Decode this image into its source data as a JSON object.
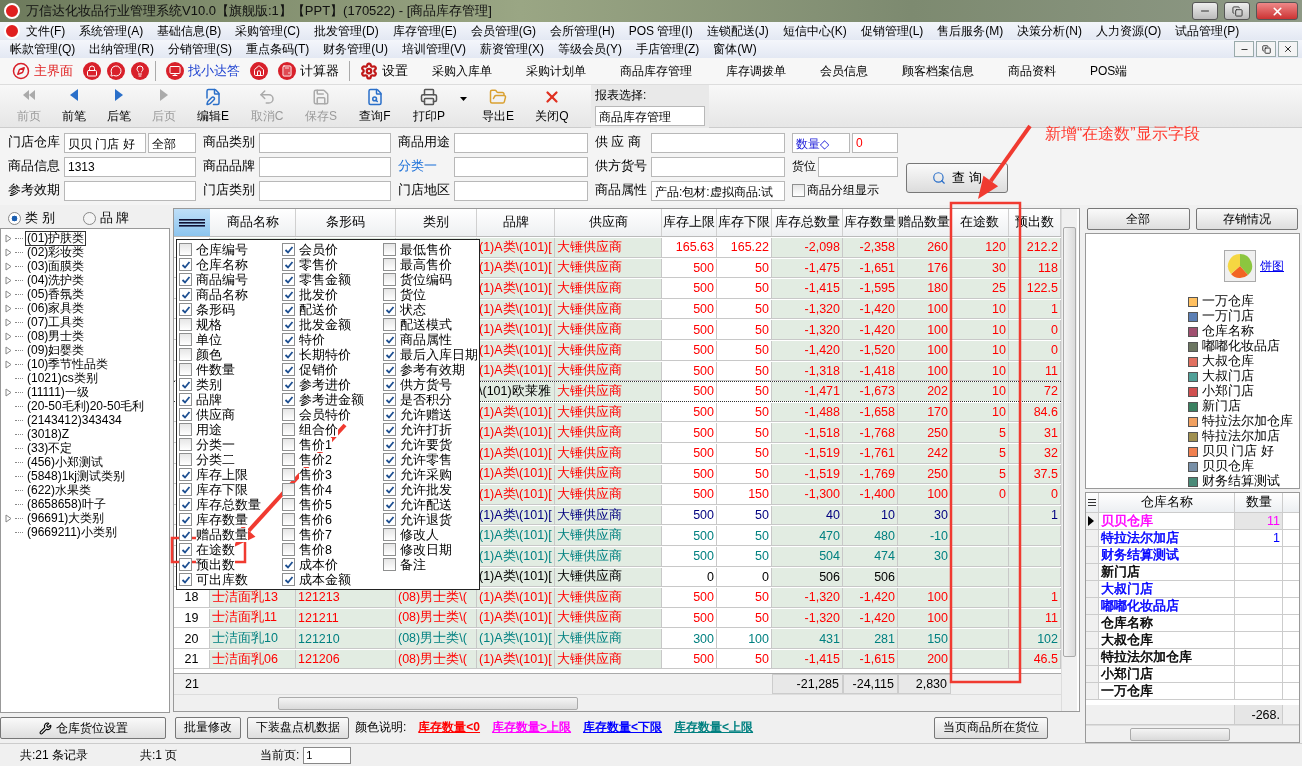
{
  "window": {
    "title": "万信达化妆品行业管理系统V10.0【旗舰版:1】【PPT】(170522) - [商品库存管理]"
  },
  "menus": [
    [
      "文件(F)",
      "系统管理(A)",
      "基础信息(B)",
      "采购管理(C)",
      "批发管理(D)",
      "库存管理(E)",
      "会员管理(G)",
      "会所管理(H)",
      "POS 管理(I)",
      "连锁配送(J)",
      "短信中心(K)",
      "促销管理(L)",
      "售后服务(M)",
      "决策分析(N)",
      "人力资源(O)",
      "试品管理(P)"
    ],
    [
      "帐款管理(Q)",
      "出纳管理(R)",
      "分销管理(S)",
      "重点条码(T)",
      "财务管理(U)",
      "培训管理(V)",
      "薪资管理(X)",
      "等级会员(Y)",
      "手店管理(Z)",
      "窗体(W)"
    ]
  ],
  "quick_bar": [
    {
      "kind": "home",
      "label": "主界面"
    },
    {
      "kind": "lock"
    },
    {
      "kind": "chat"
    },
    {
      "kind": "bulb"
    },
    {
      "kind": "separator"
    },
    {
      "kind": "help",
      "label": "找小达答"
    },
    {
      "kind": "house"
    },
    {
      "kind": "calculator",
      "label": "计算器"
    },
    {
      "kind": "separator"
    },
    {
      "kind": "settings",
      "label": "设置"
    },
    {
      "kind": "link",
      "label": "采购入库单"
    },
    {
      "kind": "link",
      "label": "采购计划单"
    },
    {
      "kind": "link",
      "label": "商品库存管理"
    },
    {
      "kind": "link",
      "label": "库存调拨单"
    },
    {
      "kind": "link",
      "label": "会员信息"
    },
    {
      "kind": "link",
      "label": "顾客档案信息"
    },
    {
      "kind": "link",
      "label": "商品资料"
    },
    {
      "kind": "link",
      "label": "POS端"
    }
  ],
  "toolbar": [
    {
      "kind": "first",
      "label": "前页",
      "disabled": true
    },
    {
      "kind": "prev",
      "label": "前笔",
      "disabled": false
    },
    {
      "kind": "next",
      "label": "后笔",
      "disabled": false
    },
    {
      "kind": "last",
      "label": "后页",
      "disabled": true
    },
    {
      "kind": "edit",
      "label": "编辑E",
      "disabled": false
    },
    {
      "kind": "cancel",
      "label": "取消C",
      "disabled": true
    },
    {
      "kind": "save",
      "label": "保存S",
      "disabled": true
    },
    {
      "kind": "query",
      "label": "查询F",
      "disabled": false
    },
    {
      "kind": "print",
      "label": "打印P",
      "disabled": false
    },
    {
      "kind": "dropdown"
    },
    {
      "kind": "export",
      "label": "导出E",
      "disabled": false
    },
    {
      "kind": "close",
      "label": "关闭Q",
      "disabled": false
    }
  ],
  "report_select": {
    "label": "报表选择:",
    "value": "商品库存管理"
  },
  "filters": [
    [
      {
        "kind": "field",
        "label": "门店仓库",
        "value": "贝贝 门店 好",
        "extra": "全部"
      },
      {
        "kind": "field",
        "label": "商品类别"
      },
      {
        "kind": "field",
        "label": "商品用途"
      },
      {
        "kind": "field",
        "label": "供 应 商"
      },
      {
        "kind": "compare",
        "label": "数量◇",
        "value": "0"
      }
    ],
    [
      {
        "kind": "field",
        "label": "商品信息",
        "value": "1313"
      },
      {
        "kind": "field",
        "label": "商品品牌"
      },
      {
        "kind": "link",
        "label": "分类一"
      },
      {
        "kind": "field",
        "label": "供方货号"
      },
      {
        "kind": "small",
        "label": "货位"
      }
    ],
    [
      {
        "kind": "field",
        "label": "参考效期"
      },
      {
        "kind": "field",
        "label": "门店类别"
      },
      {
        "kind": "field",
        "label": "门店地区"
      },
      {
        "kind": "field",
        "label": "商品属性",
        "value": "产品:包材:虚拟商品:试"
      },
      {
        "kind": "checkbox",
        "label": "商品分组显示",
        "checked": false
      }
    ]
  ],
  "query_button": "查 询",
  "annotation": {
    "note": "新增“在途数”显示字段"
  },
  "category_switch": [
    {
      "label": "类 别",
      "selected": true
    },
    {
      "label": "品 牌",
      "selected": false
    }
  ],
  "tree": [
    {
      "kind": "branch",
      "label": "(01)护肤类",
      "selected": true
    },
    {
      "kind": "branch",
      "label": "(02)彩妆类",
      "selected": false
    },
    {
      "kind": "branch",
      "label": "(03)面膜类",
      "selected": false
    },
    {
      "kind": "branch",
      "label": "(04)洗护类",
      "selected": false
    },
    {
      "kind": "branch",
      "label": "(05)香氛类",
      "selected": false
    },
    {
      "kind": "branch",
      "label": "(06)家具类",
      "selected": false
    },
    {
      "kind": "branch",
      "label": "(07)工具类",
      "selected": false
    },
    {
      "kind": "branch",
      "label": "(08)男士类",
      "selected": false
    },
    {
      "kind": "branch",
      "label": "(09)妇婴类",
      "selected": false
    },
    {
      "kind": "branch",
      "label": "(10)季节性品类",
      "selected": false
    },
    {
      "kind": "leaf",
      "label": "(1021)cs类别",
      "selected": false
    },
    {
      "kind": "branch",
      "label": "(11111)一级",
      "selected": false
    },
    {
      "kind": "leaf",
      "label": "(20-50毛利)20-50毛利",
      "selected": false
    },
    {
      "kind": "leaf",
      "label": "(2143412)343434",
      "selected": false
    },
    {
      "kind": "leaf",
      "label": "(3018)Z",
      "selected": false
    },
    {
      "kind": "leaf",
      "label": "(33)不定",
      "selected": false
    },
    {
      "kind": "leaf",
      "label": "(456)小郑测试",
      "selected": false
    },
    {
      "kind": "leaf",
      "label": "(5848)1kj测试类别",
      "selected": false
    },
    {
      "kind": "leaf",
      "label": "(622)水果类",
      "selected": false
    },
    {
      "kind": "leaf",
      "label": "(8658658)叶子",
      "selected": false
    },
    {
      "kind": "branch",
      "label": "(96691)大类别",
      "selected": false
    },
    {
      "kind": "leaf",
      "label": "(9669211)小类别",
      "selected": false
    }
  ],
  "location_settings_button": "仓库货位设置",
  "grid": {
    "columns": [
      {
        "label": "商品名称",
        "sorted": false
      },
      {
        "label": "条形码",
        "sorted": false
      },
      {
        "label": "类别",
        "sorted": false
      },
      {
        "label": "品牌",
        "sorted": false
      },
      {
        "label": "供应商",
        "sorted": false
      },
      {
        "label": "库存上限",
        "sorted": false
      },
      {
        "label": "库存下限",
        "sorted": false
      },
      {
        "label": "库存总数量",
        "sorted": false
      },
      {
        "label": "库存数量",
        "sorted": false
      },
      {
        "label": "赠品数量",
        "sorted": false
      },
      {
        "label": "在途数",
        "sorted": true
      },
      {
        "label": "预出数",
        "sorted": false
      }
    ],
    "rows": [
      {
        "color": "#ff0000",
        "selected": false,
        "brand": "(1)A类\\(101)[",
        "supplier": "大锤供应商",
        "stock_max": "165.63",
        "stock_min": "165.22",
        "stock_total": "-2,098",
        "stock_qty": "-2,358",
        "gift_qty": "260",
        "in_transit": "120",
        "pre_out": "212.2"
      },
      {
        "color": "#ff0000",
        "selected": false,
        "brand": "(1)A类\\(101)[",
        "supplier": "大锤供应商",
        "stock_max": "500",
        "stock_min": "50",
        "stock_total": "-1,475",
        "stock_qty": "-1,651",
        "gift_qty": "176",
        "in_transit": "30",
        "pre_out": "118"
      },
      {
        "color": "#ff0000",
        "selected": false,
        "brand": "(1)A类\\(101)[",
        "supplier": "大锤供应商",
        "stock_max": "500",
        "stock_min": "50",
        "stock_total": "-1,415",
        "stock_qty": "-1,595",
        "gift_qty": "180",
        "in_transit": "25",
        "pre_out": "122.5"
      },
      {
        "color": "#ff0000",
        "selected": false,
        "brand": "(1)A类\\(101)[",
        "supplier": "大锤供应商",
        "stock_max": "500",
        "stock_min": "50",
        "stock_total": "-1,320",
        "stock_qty": "-1,420",
        "gift_qty": "100",
        "in_transit": "10",
        "pre_out": "1"
      },
      {
        "color": "#ff0000",
        "selected": false,
        "brand": "(1)A类\\(101)[",
        "supplier": "大锤供应商",
        "stock_max": "500",
        "stock_min": "50",
        "stock_total": "-1,320",
        "stock_qty": "-1,420",
        "gift_qty": "100",
        "in_transit": "10",
        "pre_out": "0"
      },
      {
        "color": "#ff0000",
        "selected": false,
        "brand": "(1)A类\\(101)[",
        "supplier": "大锤供应商",
        "stock_max": "500",
        "stock_min": "50",
        "stock_total": "-1,420",
        "stock_qty": "-1,520",
        "gift_qty": "100",
        "in_transit": "10",
        "pre_out": "0"
      },
      {
        "color": "#ff0000",
        "selected": false,
        "brand": "(1)A类\\(101)[",
        "supplier": "大锤供应商",
        "stock_max": "500",
        "stock_min": "50",
        "stock_total": "-1,318",
        "stock_qty": "-1,418",
        "gift_qty": "100",
        "in_transit": "10",
        "pre_out": "11"
      },
      {
        "color": "#ff0000",
        "selected": true,
        "brand": "\\(101)欧莱雅",
        "supplier": "大锤供应商",
        "stock_max": "500",
        "stock_min": "50",
        "stock_total": "-1,471",
        "stock_qty": "-1,673",
        "gift_qty": "202",
        "in_transit": "10",
        "pre_out": "72"
      },
      {
        "color": "#ff0000",
        "selected": false,
        "brand": "(1)A类\\(101)[",
        "supplier": "大锤供应商",
        "stock_max": "500",
        "stock_min": "50",
        "stock_total": "-1,488",
        "stock_qty": "-1,658",
        "gift_qty": "170",
        "in_transit": "10",
        "pre_out": "84.6"
      },
      {
        "color": "#ff0000",
        "selected": false,
        "brand": "(1)A类\\(101)[",
        "supplier": "大锤供应商",
        "stock_max": "500",
        "stock_min": "50",
        "stock_total": "-1,518",
        "stock_qty": "-1,768",
        "gift_qty": "250",
        "in_transit": "5",
        "pre_out": "31"
      },
      {
        "color": "#ff0000",
        "selected": false,
        "brand": "(1)A类\\(101)[",
        "supplier": "大锤供应商",
        "stock_max": "500",
        "stock_min": "50",
        "stock_total": "-1,519",
        "stock_qty": "-1,761",
        "gift_qty": "242",
        "in_transit": "5",
        "pre_out": "32"
      },
      {
        "color": "#ff0000",
        "selected": false,
        "brand": "(1)A类\\(101)[",
        "supplier": "大锤供应商",
        "stock_max": "500",
        "stock_min": "50",
        "stock_total": "-1,519",
        "stock_qty": "-1,769",
        "gift_qty": "250",
        "in_transit": "5",
        "pre_out": "37.5"
      },
      {
        "color": "#ff0000",
        "selected": false,
        "brand": "(1)A类\\(101)[",
        "supplier": "大锤供应商",
        "stock_max": "500",
        "stock_min": "150",
        "stock_total": "-1,300",
        "stock_qty": "-1,400",
        "gift_qty": "100",
        "in_transit": "0",
        "pre_out": "0"
      },
      {
        "color": "#00007f",
        "selected": false,
        "brand": "(1)A类\\(101)[",
        "supplier": "大锤供应商",
        "stock_max": "500",
        "stock_min": "50",
        "stock_total": "40",
        "stock_qty": "10",
        "gift_qty": "30",
        "pre_out": "1"
      },
      {
        "color": "#008080",
        "selected": false,
        "brand": "(1)A类\\(101)[",
        "supplier": "大锤供应商",
        "stock_max": "500",
        "stock_min": "50",
        "stock_total": "470",
        "stock_qty": "480",
        "gift_qty": "-10"
      },
      {
        "color": "#008080",
        "selected": false,
        "brand": "(1)A类\\(101)[",
        "supplier": "大锤供应商",
        "stock_max": "500",
        "stock_min": "50",
        "stock_total": "504",
        "stock_qty": "474",
        "gift_qty": "30"
      },
      {
        "color": "#000000",
        "selected": false,
        "brand": "(1)A类\\(101)[",
        "supplier": "大锤供应商",
        "stock_max": "0",
        "stock_min": "0",
        "stock_total": "506",
        "stock_qty": "506"
      },
      {
        "color": "#ff0000",
        "selected": false,
        "no": "18",
        "name": "士洁面乳13",
        "barcode": "121213",
        "category": "(08)男士类\\(",
        "brand": "(1)A类\\(101)[",
        "supplier": "大锤供应商",
        "stock_max": "500",
        "stock_min": "50",
        "stock_total": "-1,320",
        "stock_qty": "-1,420",
        "gift_qty": "100",
        "pre_out": "1"
      },
      {
        "color": "#ff0000",
        "selected": false,
        "no": "19",
        "name": "士洁面乳11",
        "barcode": "121211",
        "category": "(08)男士类\\(",
        "brand": "(1)A类\\(101)[",
        "supplier": "大锤供应商",
        "stock_max": "500",
        "stock_min": "50",
        "stock_total": "-1,320",
        "stock_qty": "-1,420",
        "gift_qty": "100",
        "pre_out": "11"
      },
      {
        "color": "#008080",
        "selected": false,
        "no": "20",
        "name": "士洁面乳10",
        "barcode": "121210",
        "category": "(08)男士类\\(",
        "brand": "(1)A类\\(101)[",
        "supplier": "大锤供应商",
        "stock_max": "300",
        "stock_min": "100",
        "stock_total": "431",
        "stock_qty": "281",
        "gift_qty": "150",
        "pre_out": "102"
      },
      {
        "color": "#ff0000",
        "selected": false,
        "no": "21",
        "name": "士洁面乳06",
        "barcode": "121206",
        "category": "(08)男士类\\(",
        "brand": "(1)A类\\(101)[",
        "supplier": "大锤供应商",
        "stock_max": "500",
        "stock_min": "50",
        "stock_total": "-1,415",
        "stock_qty": "-1,615",
        "gift_qty": "200",
        "pre_out": "46.5"
      }
    ],
    "footer": {
      "count": "21",
      "stock_total": "-21,285",
      "stock_qty": "-24,115",
      "gift_qty": "2,830"
    }
  },
  "column_chooser": [
    {
      "label": "仓库编号",
      "checked": false
    },
    {
      "label": "仓库名称",
      "checked": true
    },
    {
      "label": "商品编号",
      "checked": true
    },
    {
      "label": "商品名称",
      "checked": true
    },
    {
      "label": "条形码",
      "checked": true
    },
    {
      "label": "规格",
      "checked": false
    },
    {
      "label": "单位",
      "checked": false
    },
    {
      "label": "颜色",
      "checked": false
    },
    {
      "label": "件数量",
      "checked": false
    },
    {
      "label": "类别",
      "checked": true
    },
    {
      "label": "品牌",
      "checked": true
    },
    {
      "label": "供应商",
      "checked": true
    },
    {
      "label": "用途",
      "checked": false
    },
    {
      "label": "分类一",
      "checked": false
    },
    {
      "label": "分类二",
      "checked": false
    },
    {
      "label": "库存上限",
      "checked": true
    },
    {
      "label": "库存下限",
      "checked": true
    },
    {
      "label": "库存总数量",
      "checked": true
    },
    {
      "label": "库存数量",
      "checked": true
    },
    {
      "label": "赠品数量",
      "checked": true
    },
    {
      "label": "在途数",
      "checked": true
    },
    {
      "label": "预出数",
      "checked": true
    },
    {
      "label": "可出库数",
      "checked": true
    },
    {
      "label": "会员价",
      "checked": true
    },
    {
      "label": "零售价",
      "checked": true
    },
    {
      "label": "零售金额",
      "checked": true
    },
    {
      "label": "批发价",
      "checked": true
    },
    {
      "label": "配送价",
      "checked": true
    },
    {
      "label": "批发金额",
      "checked": true
    },
    {
      "label": "特价",
      "checked": true
    },
    {
      "label": "长期特价",
      "checked": true
    },
    {
      "label": "促销价",
      "checked": true
    },
    {
      "label": "参考进价",
      "checked": true
    },
    {
      "label": "参考进金额",
      "checked": true
    },
    {
      "label": "会员特价",
      "checked": false
    },
    {
      "label": "组合价",
      "checked": false
    },
    {
      "label": "售价1",
      "checked": false
    },
    {
      "label": "售价2",
      "checked": false
    },
    {
      "label": "售价3",
      "checked": false
    },
    {
      "label": "售价4",
      "checked": false
    },
    {
      "label": "售价5",
      "checked": false
    },
    {
      "label": "售价6",
      "checked": false
    },
    {
      "label": "售价7",
      "checked": false
    },
    {
      "label": "售价8",
      "checked": false
    },
    {
      "label": "成本价",
      "checked": true
    },
    {
      "label": "成本金额",
      "checked": true
    },
    {
      "label": "最低售价",
      "checked": false
    },
    {
      "label": "最高售价",
      "checked": false
    },
    {
      "label": "货位编码",
      "checked": false
    },
    {
      "label": "货位",
      "checked": false
    },
    {
      "label": "状态",
      "checked": true
    },
    {
      "label": "配送模式",
      "checked": false
    },
    {
      "label": "商品属性",
      "checked": true
    },
    {
      "label": "最后入库日期",
      "checked": true
    },
    {
      "label": "参考有效期",
      "checked": true
    },
    {
      "label": "供方货号",
      "checked": true
    },
    {
      "label": "是否积分",
      "checked": true
    },
    {
      "label": "允许赠送",
      "checked": true
    },
    {
      "label": "允许打折",
      "checked": true
    },
    {
      "label": "允许要货",
      "checked": true
    },
    {
      "label": "允许零售",
      "checked": true
    },
    {
      "label": "允许采购",
      "checked": true
    },
    {
      "label": "允许批发",
      "checked": true
    },
    {
      "label": "允许配送",
      "checked": true
    },
    {
      "label": "允许退货",
      "checked": true
    },
    {
      "label": "修改人",
      "checked": false
    },
    {
      "label": "修改日期",
      "checked": false
    },
    {
      "label": "备注",
      "checked": false
    }
  ],
  "right_panel": {
    "buttons": [
      "全部",
      "存销情况"
    ],
    "chart_link": "饼图",
    "legend": [
      {
        "label": "一万仓库",
        "color": "#ffc060"
      },
      {
        "label": "一万门店",
        "color": "#5b7fb5"
      },
      {
        "label": "仓库名称",
        "color": "#a05070"
      },
      {
        "label": "嘟嘟化妆品店",
        "color": "#6b7560"
      },
      {
        "label": "大叔仓库",
        "color": "#e07060"
      },
      {
        "label": "大叔门店",
        "color": "#50a098"
      },
      {
        "label": "小郑门店",
        "color": "#d05050"
      },
      {
        "label": "新门店",
        "color": "#3a8060"
      },
      {
        "label": "特拉法尔加仓库",
        "color": "#f0a060"
      },
      {
        "label": "特拉法尔加店",
        "color": "#a09050"
      },
      {
        "label": "贝贝 门店 好",
        "color": "#f08050"
      },
      {
        "label": "贝贝仓库",
        "color": "#7890a8"
      },
      {
        "label": "财务结算测试",
        "color": "#4a8a78"
      }
    ],
    "table": {
      "columns": [
        "仓库名称",
        "数量"
      ],
      "rows": [
        {
          "name": "贝贝仓库",
          "qty": "11",
          "color": "#ff00ff",
          "selected": true
        },
        {
          "name": "特拉法尔加店",
          "qty": "1",
          "color": "#0000ff",
          "selected": false
        },
        {
          "name": "财务结算测试",
          "color": "#0000ff",
          "selected": false
        },
        {
          "name": "新门店",
          "color": "#000000",
          "selected": false
        },
        {
          "name": "大叔门店",
          "color": "#0000ff",
          "selected": false
        },
        {
          "name": "嘟嘟化妆品店",
          "color": "#0000ff",
          "selected": false
        },
        {
          "name": "仓库名称",
          "color": "#000000",
          "selected": false
        },
        {
          "name": "大叔仓库",
          "color": "#000000",
          "selected": false
        },
        {
          "name": "特拉法尔加仓库",
          "color": "#000000",
          "selected": false
        },
        {
          "name": "小郑门店",
          "color": "#000000",
          "selected": false
        },
        {
          "name": "一万仓库",
          "color": "#000000",
          "selected": false
        }
      ],
      "footer": "-268."
    }
  },
  "bottom_bar": {
    "buttons": [
      "批量修改",
      "下装盘点机数据"
    ],
    "legend_label": "颜色说明:",
    "legend": [
      {
        "text": "库存数量<0",
        "color": "#ff0000"
      },
      {
        "text": "库存数量>上限",
        "color": "#ff00ff"
      },
      {
        "text": "库存数量<下限",
        "color": "#0000ff"
      },
      {
        "text": "库存数量<上限",
        "color": "#008080"
      }
    ],
    "location_button": "当页商品所在货位"
  },
  "status_bar": {
    "items": [
      "共:21 条记录",
      "共:1 页"
    ],
    "page_label": "当前页:",
    "page": "1"
  }
}
